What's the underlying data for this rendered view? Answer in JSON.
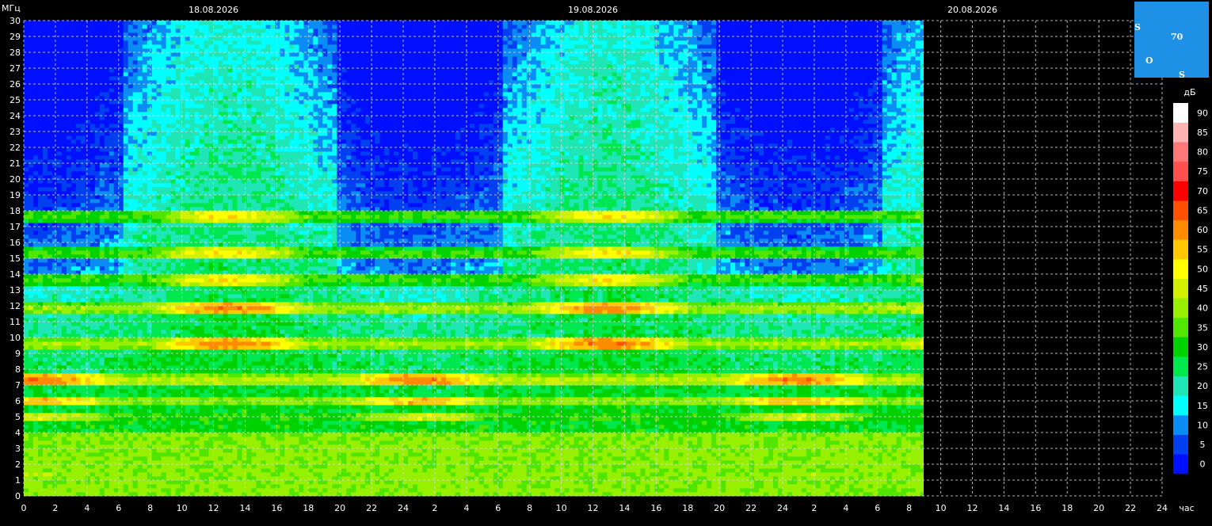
{
  "chart_data": {
    "type": "heatmap",
    "title": "",
    "ylabel": "МГц",
    "xlabel": "час",
    "colorbar_label": "дБ",
    "ylim": [
      0,
      30
    ],
    "yticks": [
      0,
      1,
      2,
      3,
      4,
      5,
      6,
      7,
      8,
      9,
      10,
      11,
      12,
      13,
      14,
      15,
      16,
      17,
      18,
      19,
      20,
      21,
      22,
      23,
      24,
      25,
      26,
      27,
      28,
      29,
      30
    ],
    "xlim_hours": [
      0,
      72
    ],
    "xtick_labels": [
      "0",
      "2",
      "4",
      "6",
      "8",
      "10",
      "12",
      "14",
      "16",
      "18",
      "20",
      "22",
      "24",
      "2",
      "4",
      "6",
      "8",
      "10",
      "12",
      "14",
      "16",
      "18",
      "20",
      "22",
      "24",
      "2",
      "4",
      "6",
      "8",
      "10",
      "12",
      "14",
      "16",
      "18",
      "20",
      "22",
      "24"
    ],
    "date_labels": [
      {
        "label": "18.08.2026",
        "hour": 12
      },
      {
        "label": "19.08.2026",
        "hour": 36
      },
      {
        "label": "20.08.2026",
        "hour": 60
      }
    ],
    "data_end_hour": 56.9,
    "colorbar": {
      "levels": [
        0,
        5,
        10,
        15,
        20,
        25,
        30,
        35,
        40,
        45,
        50,
        55,
        60,
        65,
        70,
        75,
        80,
        85,
        90
      ],
      "colors": [
        "#0010ff",
        "#0040f0",
        "#0a8cf5",
        "#00ffff",
        "#1ee6b4",
        "#00e850",
        "#00d200",
        "#50e600",
        "#96f000",
        "#d2f000",
        "#ffff00",
        "#ffc800",
        "#ff8c00",
        "#ff5000",
        "#ff0000",
        "#ff5050",
        "#ff7878",
        "#ffb4b4",
        "#ffffff"
      ]
    },
    "grid": true,
    "bands_mhz": [
      {
        "freq": 9.6,
        "peak_db": 65
      },
      {
        "freq": 7.3,
        "peak_db": 65
      },
      {
        "freq": 11.8,
        "peak_db": 65
      },
      {
        "freq": 6.0,
        "peak_db": 60
      },
      {
        "freq": 13.7,
        "peak_db": 55
      },
      {
        "freq": 15.3,
        "peak_db": 55
      },
      {
        "freq": 17.7,
        "peak_db": 55
      },
      {
        "freq": 5.0,
        "peak_db": 50
      },
      {
        "freq": 1.3,
        "peak_db": 45
      }
    ]
  },
  "logo": {
    "letters": [
      "S",
      "O",
      "S"
    ],
    "number": "70"
  }
}
